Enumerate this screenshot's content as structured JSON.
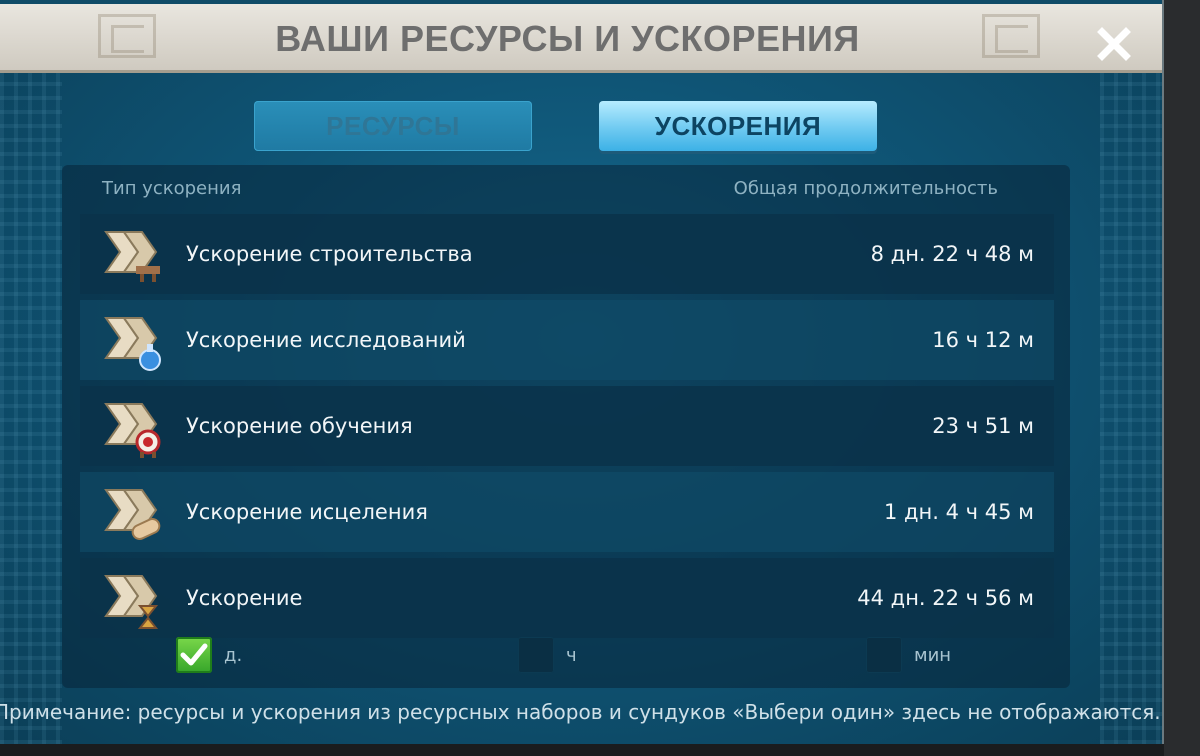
{
  "window": {
    "title": "ВАШИ РЕСУРСЫ И УСКОРЕНИЯ",
    "close_icon": "close-icon"
  },
  "tabs": [
    {
      "label": "РЕСУРСЫ",
      "active": false
    },
    {
      "label": "УСКОРЕНИЯ",
      "active": true
    }
  ],
  "table": {
    "col_type": "Тип ускорения",
    "col_duration": "Общая продолжительность",
    "rows": [
      {
        "label": "Ускорение строительства",
        "value": "8 дн. 22 ч 48 м",
        "icon": "construction-speedup-icon"
      },
      {
        "label": "Ускорение исследований",
        "value": "16 ч 12 м",
        "icon": "research-speedup-icon"
      },
      {
        "label": "Ускорение обучения",
        "value": "23 ч 51 м",
        "icon": "training-speedup-icon"
      },
      {
        "label": "Ускорение исцеления",
        "value": "1 дн. 4 ч 45 м",
        "icon": "healing-speedup-icon"
      },
      {
        "label": "Ускорение",
        "value": "44 дн. 22 ч 56 м",
        "icon": "universal-speedup-icon"
      }
    ]
  },
  "filters": [
    {
      "label": "д.",
      "checked": true
    },
    {
      "label": "ч",
      "checked": false
    },
    {
      "label": "мин",
      "checked": false
    }
  ],
  "note": "Примечание: ресурсы и ускорения из ресурсных наборов и сундуков «Выбери один» здесь не отображаются.",
  "colors": {
    "panel": "#0f4b67",
    "active_tab": "#6fcaf1",
    "check_green": "#35a52a"
  }
}
